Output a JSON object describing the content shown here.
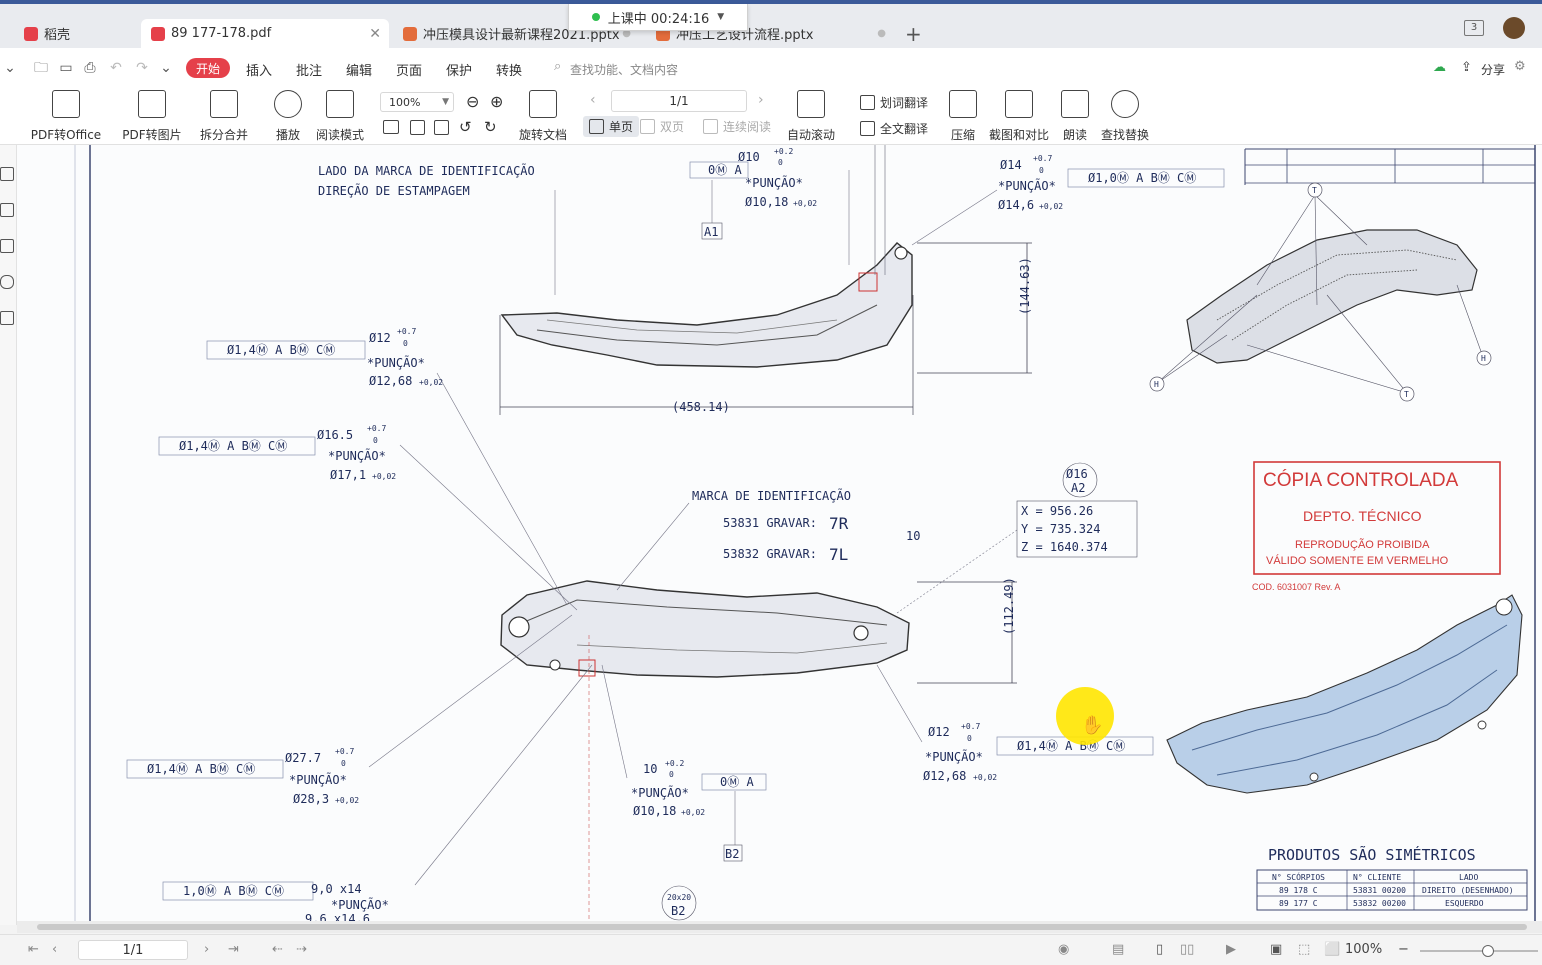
{
  "tabs": [
    {
      "label": "稻壳",
      "icon": "docer-icon",
      "color": "#e5404a"
    },
    {
      "label": "89 177-178.pdf",
      "icon": "pdf-icon",
      "color": "#e5404a"
    },
    {
      "label": "冲压模具设计最新课程2021.pptx",
      "icon": "pptx-icon",
      "color": "#e36c3b"
    },
    {
      "label": "冲压工艺设计流程.pptx",
      "icon": "pptx-icon",
      "color": "#e36c3b"
    }
  ],
  "class_timer": "上课中 00:24:16",
  "window_badge": "3",
  "menu": {
    "start": "开始",
    "items": [
      "插入",
      "批注",
      "编辑",
      "页面",
      "保护",
      "转换"
    ],
    "search_placeholder": "查找功能、文档内容",
    "share": "分享"
  },
  "ribbon": {
    "pdf_to_office": "PDF转Office",
    "pdf_to_image": "PDF转图片",
    "split_merge": "拆分合并",
    "play": "播放",
    "read_mode": "阅读模式",
    "zoom": "100%",
    "rotate_doc": "旋转文档",
    "page": "1/1",
    "single": "单页",
    "double": "双页",
    "continuous": "连续阅读",
    "auto_scroll": "自动滚动",
    "word_translate": "划词翻译",
    "full_translate": "全文翻译",
    "compress": "压缩",
    "screenshot_compare": "截图和对比",
    "read_aloud": "朗读",
    "find_replace": "查找替换"
  },
  "drawing": {
    "note_side": "LADO DA MARCA DE IDENTIFICAÇÃO",
    "note_dir": "DIREÇÃO DE ESTAMPAGEM",
    "dim_458": "(458.14)",
    "dim_144": "(144.63)",
    "dim_112": "(112.49)",
    "marca": "MARCA DE IDENTIFICAÇÃO",
    "gravar_r": "53831 GRAVAR:",
    "gravar_l": "53832 GRAVAR:",
    "seven_r": "7R",
    "seven_l": "7L",
    "ten": "10",
    "coord_x": "X  =  956.26",
    "coord_y": "Y  =  735.324",
    "coord_z": "Z  =  1640.374",
    "o16": "Ø16",
    "a2": "A2",
    "a1": "A1",
    "b2": "B2",
    "b2_box": "20x20",
    "puncao": "*PUNÇÃO*",
    "fcf_a": "Ø1,4Ⓜ A BⓂ CⓂ",
    "fcf_b": "Ø1,0Ⓜ A BⓂ CⓂ",
    "fcf_c": "1,0Ⓜ A BⓂ CⓂ",
    "fcf_zero": "0Ⓜ A",
    "h1": "Ø12",
    "h1b": "Ø12,68",
    "h2": "Ø16.5",
    "h2b": "Ø17,1",
    "h3": "Ø27.7",
    "h3b": "Ø28,3",
    "h4": "Ø10",
    "h4b": "Ø10,18",
    "h5": "Ø14",
    "h5b": "Ø14,6",
    "h6": "Ø12",
    "h6b": "Ø12,68",
    "h7": "10",
    "h7b": "Ø10,18",
    "h8": "9,0    x14",
    "h8b": "9,6    x14,6",
    "tol_up": "+0.7",
    "tol_zero": "0",
    "tol_b": "+0,02",
    "tol_10": "+0.2",
    "stamp_title": "CÓPIA CONTROLADA",
    "stamp_dept": "DEPTO. TÉCNICO",
    "stamp_l1": "REPRODUÇÃO PROIBIDA",
    "stamp_l2": "VÁLIDO SOMENTE EM VERMELHO",
    "stamp_cod": "COD. 6031007 Rev. A",
    "sym_title": "PRODUTOS SÃO SIMÉTRICOS",
    "table_head": [
      "N° SCÓRPIOS",
      "N° CLIENTE",
      "LADO"
    ],
    "table_rows": [
      [
        "89 178 C",
        "53831 00200",
        "DIREITO (DESENHADO)"
      ],
      [
        "89 177 C",
        "53832 00200",
        "ESQUERDO"
      ]
    ],
    "tag_t": "T",
    "tag_h": "H"
  },
  "status": {
    "page": "1/1",
    "zoom": "100%"
  }
}
